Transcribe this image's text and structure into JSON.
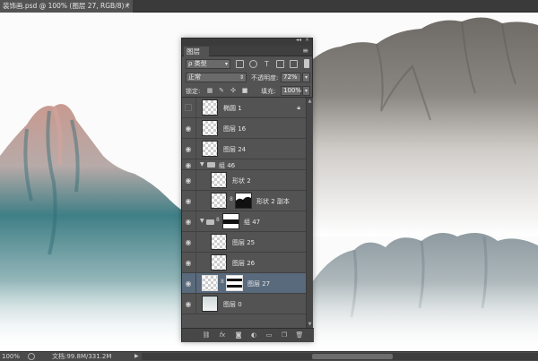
{
  "document": {
    "tab_title": "装饰画.psd @ 100% (图层 27, RGB/8) *",
    "close_glyph": "×"
  },
  "panel": {
    "title": "图层",
    "menu_glyph": "≡",
    "collapse_glyph": "◂◂",
    "close_glyph": "×",
    "filter": {
      "kind_label": "ρ 类型"
    },
    "blend_mode": "正常",
    "opacity_label": "不透明度:",
    "opacity_value": "72%",
    "lock_label": "锁定:",
    "fill_label": "填充:",
    "fill_value": "100%",
    "layers": [
      {
        "name": "椭圆 1",
        "visible": false,
        "locked": true
      },
      {
        "name": "图层 16",
        "visible": true
      },
      {
        "name": "图层 24",
        "visible": true
      },
      {
        "name": "组 46",
        "visible": true,
        "group": true
      },
      {
        "name": "形状 2",
        "visible": true
      },
      {
        "name": "形状 2 副本",
        "visible": true
      },
      {
        "name": "组 47",
        "visible": true,
        "group": true
      },
      {
        "name": "图层 25",
        "visible": true
      },
      {
        "name": "图层 26",
        "visible": true
      },
      {
        "name": "图层 27",
        "visible": true,
        "selected": true
      },
      {
        "name": "图层 0",
        "visible": true
      }
    ]
  },
  "status": {
    "zoom": "100%",
    "doc_info": "文档:99.8M/331.2M",
    "arrow_glyph": "▶"
  },
  "icons": {
    "eye": "eye-icon",
    "lock": "lock-icon",
    "link": "link-icon",
    "fx": "fx-icon",
    "mask": "add-mask-icon",
    "adjust": "adjustment-layer-icon",
    "folder": "new-group-icon",
    "new": "new-layer-icon",
    "trash": "delete-layer-icon"
  }
}
